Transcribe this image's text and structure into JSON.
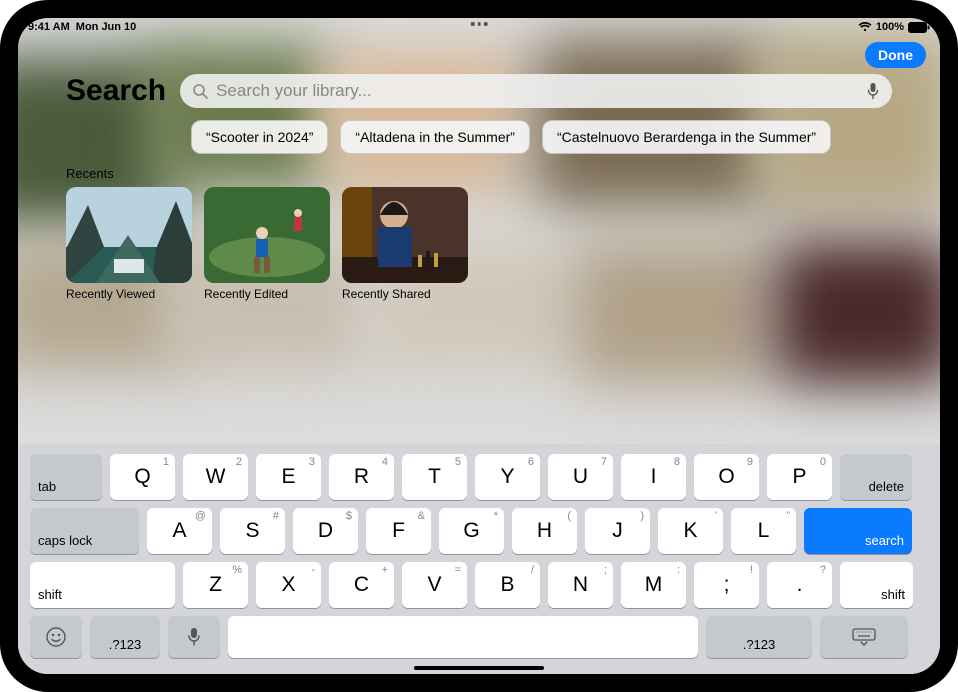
{
  "statusbar": {
    "time": "9:41 AM",
    "date": "Mon Jun 10",
    "battery_pct": "100%"
  },
  "nav": {
    "done": "Done"
  },
  "header": {
    "title": "Search",
    "placeholder": "Search your library..."
  },
  "suggestions": [
    "“Scooter in 2024”",
    "“Altadena in the Summer”",
    "“Castelnuovo Berardenga in the Summer”"
  ],
  "recents": {
    "section_label": "Recents",
    "tiles": [
      {
        "label": "Recently Viewed"
      },
      {
        "label": "Recently Edited"
      },
      {
        "label": "Recently Shared"
      }
    ]
  },
  "keyboard": {
    "tab": "tab",
    "delete": "delete",
    "caps": "caps lock",
    "search": "search",
    "shift": "shift",
    "numsym": ".?123",
    "row1_hints": [
      "1",
      "2",
      "3",
      "4",
      "5",
      "6",
      "7",
      "8",
      "9",
      "0"
    ],
    "row1": [
      "Q",
      "W",
      "E",
      "R",
      "T",
      "Y",
      "U",
      "I",
      "O",
      "P"
    ],
    "row2_hints": [
      "@",
      "#",
      "$",
      "&",
      "*",
      "(",
      ")",
      "'",
      "”"
    ],
    "row2": [
      "A",
      "S",
      "D",
      "F",
      "G",
      "H",
      "J",
      "K",
      "L"
    ],
    "row3_hints": [
      "%",
      "-",
      "+",
      "=",
      "/",
      ";",
      ":",
      "!",
      "?"
    ],
    "row3": [
      "Z",
      "X",
      "C",
      "V",
      "B",
      "N",
      "M",
      ";",
      "."
    ],
    "row3_main_punct": [
      "!",
      "?"
    ],
    "row3_punct_main": [
      ";",
      "."
    ],
    "row3_display": {
      "semi": ";",
      "dot": "."
    },
    "row3_punct": [
      {
        "hint": "!",
        "main": ";"
      },
      {
        "hint": "?",
        "main": "."
      }
    ]
  }
}
